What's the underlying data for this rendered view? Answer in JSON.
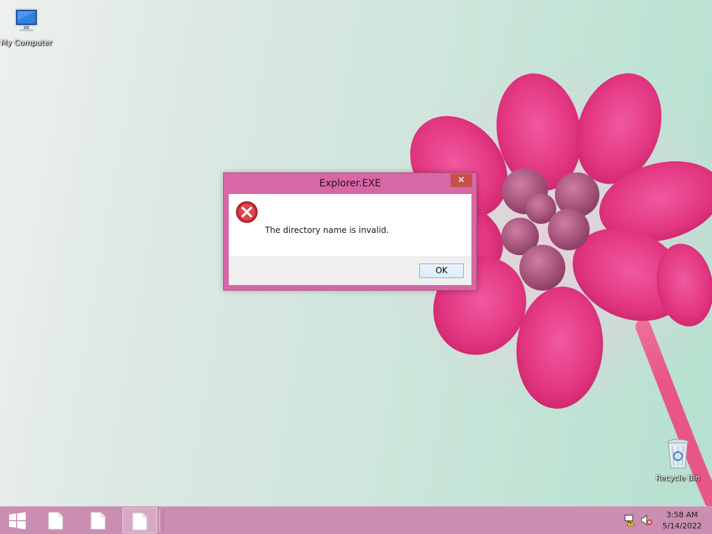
{
  "desktop": {
    "icons": [
      {
        "label": "My Computer",
        "icon": "computer-icon"
      },
      {
        "label": "Recycle Bin",
        "icon": "recycle-bin-icon"
      }
    ]
  },
  "dialog": {
    "title": "Explorer.EXE",
    "close_symbol": "✕",
    "message": "The directory name is invalid.",
    "icon": "error-icon",
    "ok_label": "OK"
  },
  "taskbar": {
    "start_icon": "windows-logo-icon",
    "task_buttons": [
      "document-icon",
      "document-icon",
      "document-icon"
    ],
    "tray": {
      "network_icon": "network-warning-icon",
      "volume_icon": "volume-muted-icon"
    },
    "clock": {
      "time": "3:58 AM",
      "date": "5/14/2022"
    }
  },
  "colors": {
    "title_bar": "#d867a6",
    "close_button": "#c7504b",
    "taskbar": "#c98eb0",
    "ok_border": "#7eb4ea"
  }
}
